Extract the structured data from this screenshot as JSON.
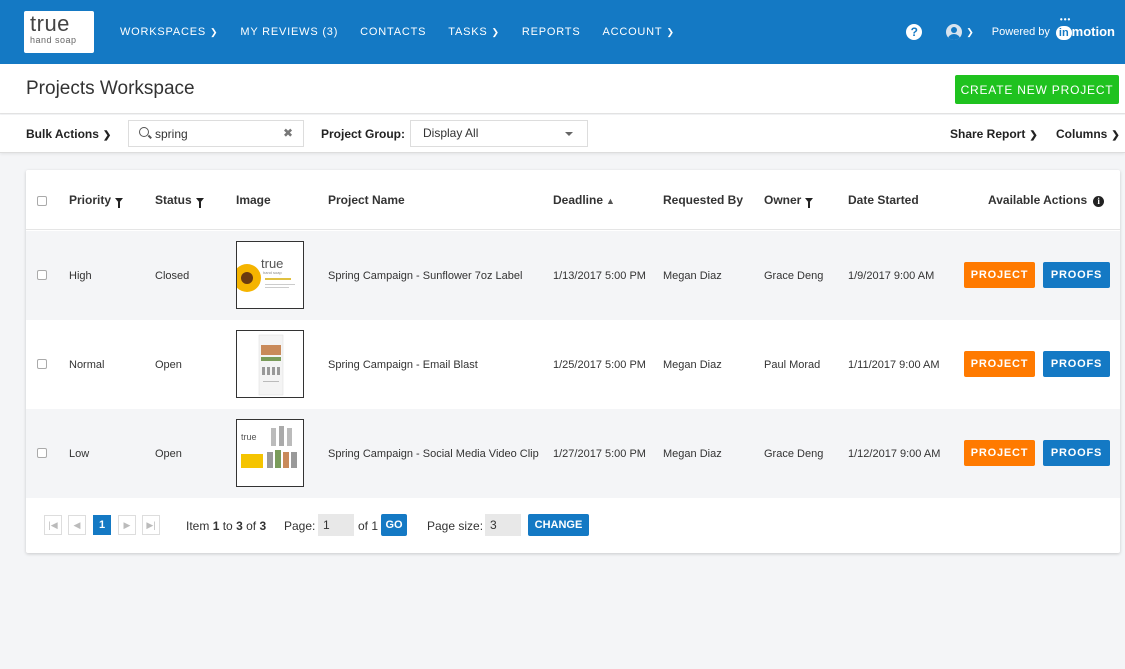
{
  "brand": {
    "logo_main": "true",
    "logo_sub": "hand soap"
  },
  "nav": {
    "items": [
      {
        "label": "WORKSPACES",
        "dropdown": true
      },
      {
        "label": "MY REVIEWS (3)",
        "dropdown": false
      },
      {
        "label": "CONTACTS",
        "dropdown": false
      },
      {
        "label": "TASKS",
        "dropdown": true
      },
      {
        "label": "REPORTS",
        "dropdown": false
      },
      {
        "label": "ACCOUNT",
        "dropdown": true
      }
    ],
    "powered_by": "Powered by",
    "inmotion_in": "in",
    "inmotion_rest": "motion"
  },
  "header": {
    "title": "Projects Workspace",
    "create_button": "CREATE NEW PROJECT"
  },
  "toolbar": {
    "bulk_actions": "Bulk Actions",
    "search_value": "spring",
    "project_group_label": "Project Group:",
    "project_group_value": "Display All",
    "share_report": "Share Report",
    "columns": "Columns"
  },
  "table": {
    "headers": {
      "priority": "Priority",
      "status": "Status",
      "image": "Image",
      "project_name": "Project Name",
      "deadline": "Deadline",
      "requested_by": "Requested By",
      "owner": "Owner",
      "date_started": "Date Started",
      "available_actions": "Available Actions"
    },
    "rows": [
      {
        "priority": "High",
        "status": "Closed",
        "project_name": "Spring Campaign - Sunflower 7oz Label",
        "deadline": "1/13/2017 5:00 PM",
        "requested_by": "Megan Diaz",
        "owner": "Grace Deng",
        "date_started": "1/9/2017 9:00 AM",
        "thumb_text": "true",
        "thumb_sub": "hand soap"
      },
      {
        "priority": "Normal",
        "status": "Open",
        "project_name": "Spring Campaign - Email Blast",
        "deadline": "1/25/2017 5:00 PM",
        "requested_by": "Megan Diaz",
        "owner": "Paul Morad",
        "date_started": "1/11/2017 9:00 AM",
        "thumb_text": "",
        "thumb_sub": ""
      },
      {
        "priority": "Low",
        "status": "Open",
        "project_name": "Spring Campaign - Social Media Video Clip",
        "deadline": "1/27/2017 5:00 PM",
        "requested_by": "Megan Diaz",
        "owner": "Grace Deng",
        "date_started": "1/12/2017 9:00 AM",
        "thumb_text": "true",
        "thumb_sub": ""
      }
    ],
    "project_button": "PROJECT",
    "proofs_button": "PROOFS"
  },
  "pager": {
    "current_page": "1",
    "item_prefix": "Item",
    "item_from": "1",
    "item_to_word": "to",
    "item_to": "3",
    "item_of_word": "of",
    "item_total": "3",
    "page_label": "Page:",
    "page_value": "1",
    "of_label": "of",
    "of_total": "1",
    "go": "GO",
    "page_size_label": "Page size:",
    "page_size_value": "3",
    "change": "CHANGE"
  },
  "colors": {
    "primary": "#1479c4",
    "create": "#1fc21f",
    "project": "#ff7a00"
  }
}
